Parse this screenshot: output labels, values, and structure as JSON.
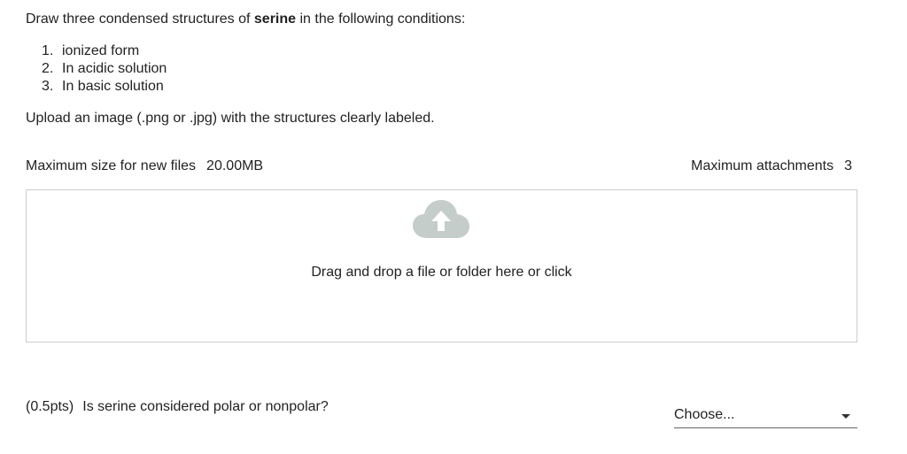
{
  "question": {
    "intro_before": "Draw three condensed structures of ",
    "intro_bold": "serine",
    "intro_after": " in the following conditions:",
    "conditions": [
      {
        "num": "1.",
        "text": "ionized form"
      },
      {
        "num": "2.",
        "text": "In acidic solution"
      },
      {
        "num": "3.",
        "text": "In basic solution"
      }
    ],
    "upload_instruction": "Upload an image (.png or .jpg) with the structures clearly labeled."
  },
  "file_upload": {
    "max_size_label": "Maximum size for new files",
    "max_size_value": "20.00MB",
    "max_attachments_label": "Maximum attachments",
    "max_attachments_value": "3",
    "dropzone_text": "Drag and drop a file or folder here or click",
    "icon": "cloud-upload-icon",
    "icon_color": "#c5cdcb"
  },
  "question2": {
    "points": "(0.5pts)",
    "text": "Is serine considered polar or nonpolar?",
    "select_value": "Choose..."
  }
}
